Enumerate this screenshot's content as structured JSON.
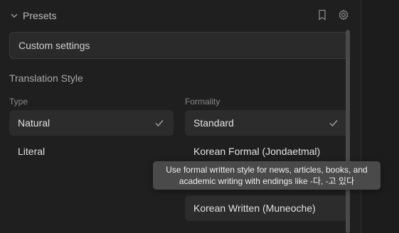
{
  "presets": {
    "title": "Presets",
    "selected": "Custom settings"
  },
  "translation_style": {
    "title": "Translation Style",
    "type": {
      "label": "Type",
      "options": [
        "Natural",
        "Literal"
      ],
      "selected": "Natural"
    },
    "formality": {
      "label": "Formality",
      "options": [
        "Standard",
        "Korean Formal (Jondaetmal)",
        "Korean Written (Muneoche)"
      ],
      "selected": "Standard"
    }
  },
  "tooltip": {
    "line1": "Use formal written style for news, articles, books, and",
    "line2": "academic writing with endings like -다, -고 있다"
  },
  "icons": {
    "collapse": "chevron-down-icon",
    "bookmark": "bookmark-icon",
    "settings": "gear-icon",
    "check": "check-icon"
  },
  "colors": {
    "background": "#1f1f1f",
    "selected_option": "#2c2c2c",
    "tooltip": "#4a4a4a"
  }
}
